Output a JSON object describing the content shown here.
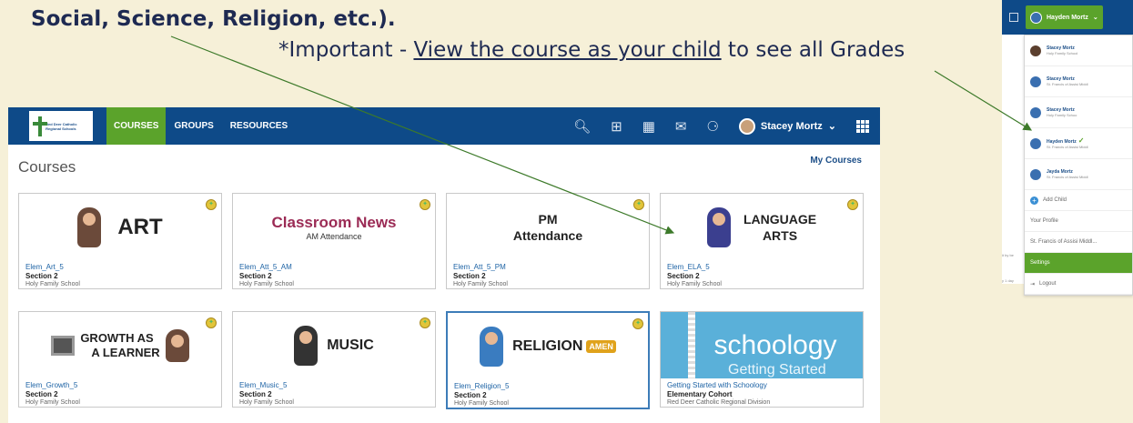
{
  "annotation": {
    "heading_fragment": "Social, Science, Religion, etc.).",
    "important_prefix": "*Important - ",
    "important_link": "View the course as your child",
    "important_suffix": " to see all Grades",
    "arrow_color": "#3d7a2a"
  },
  "app": {
    "logo_text": "Red Deer Catholic Regional Schools",
    "nav": {
      "courses": "COURSES",
      "groups": "GROUPS",
      "resources": "RESOURCES"
    },
    "nav_icons": [
      "search-icon",
      "grid-icon",
      "calendar-icon",
      "mail-icon",
      "bell-icon"
    ],
    "user_name": "Stacey Mortz",
    "page_title": "Courses",
    "my_courses": "My Courses",
    "colors": {
      "nav_bg": "#0e4a88",
      "active_green": "#5ba32b",
      "link_blue": "#1d63a5"
    },
    "cards": [
      {
        "img_label": "ART",
        "name": "Elem_Art_5",
        "section": "Section 2",
        "school": "Holy Family School"
      },
      {
        "img_label": "Classroom News",
        "img_sub": "AM Attendance",
        "name": "Elem_Att_5_AM",
        "section": "Section 2",
        "school": "Holy Family School"
      },
      {
        "img_label": "PM",
        "img_sub": "Attendance",
        "name": "Elem_Att_5_PM",
        "section": "Section 2",
        "school": "Holy Family School"
      },
      {
        "img_label": "LANGUAGE",
        "img_sub": "ARTS",
        "name": "Elem_ELA_5",
        "section": "Section 2",
        "school": "Holy Family School"
      },
      {
        "img_label": "GROWTH AS",
        "img_sub": "A LEARNER",
        "name": "Elem_Growth_5",
        "section": "Section 2",
        "school": "Holy Family School"
      },
      {
        "img_label": "MUSIC",
        "name": "Elem_Music_5",
        "section": "Section 2",
        "school": "Holy Family School"
      },
      {
        "img_label": "RELIGION",
        "img_sub": "AMEN",
        "name": "Elem_Religion_5",
        "section": "Section 2",
        "school": "Holy Family School"
      },
      {
        "img_label": "schoology",
        "img_sub": "Getting Started",
        "name": "Getting Started with Schoology",
        "section": "Elementary Cohort",
        "school": "Red Deer Catholic Regional Division"
      }
    ]
  },
  "dropdown": {
    "current_user": "Hayden Mortz",
    "accounts": [
      {
        "name": "Stacey Mortz",
        "school": "Holy Family School"
      },
      {
        "name": "Stacey Mortz",
        "school": "St. Francis of Assisi Middl"
      },
      {
        "name": "Stacey Mortz",
        "school": "Holy Family Schoo"
      },
      {
        "name": "Hayden Mortz",
        "school": "St. Francis of Assisi Middl"
      },
      {
        "name": "Jayda Mortz",
        "school": "St. Francis of Assisi Middl"
      }
    ],
    "add_child": "Add Child",
    "your_profile": "Your Profile",
    "school_link": "St. Francis of Assisi Middl...",
    "settings": "Settings",
    "logout": "Logout",
    "side_text_1": "it by be",
    "side_text_2": "y 1 day"
  }
}
